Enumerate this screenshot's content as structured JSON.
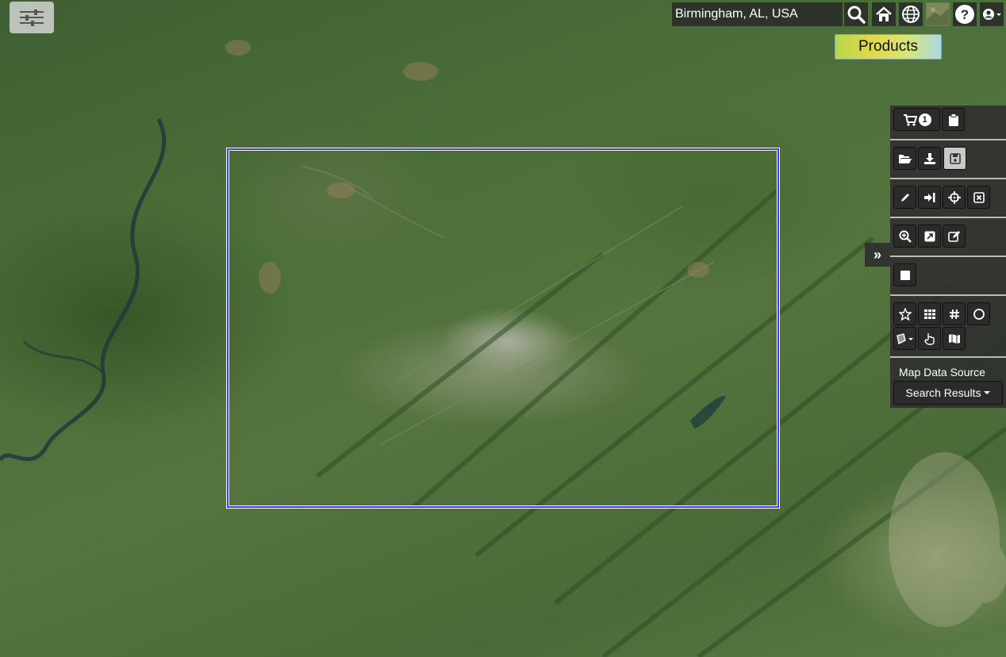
{
  "search": {
    "value": "Birmingham, AL, USA"
  },
  "products_label": "Products",
  "cart_count": "1",
  "map_data_source": {
    "label": "Map Data Source",
    "selected": "Search Results"
  },
  "expand_symbol": "»",
  "colors": {
    "aoi_border": "#3b3bff",
    "toolbar_bg": "#2d2d2d",
    "active_button": "#c9c9c9"
  },
  "icons": [
    "menu-sliders-icon",
    "search-icon",
    "home-icon",
    "globe-icon",
    "basemap-thumbnail-icon",
    "help-icon",
    "user-icon",
    "cart-icon",
    "clipboard-icon",
    "folder-open-icon",
    "download-icon",
    "save-icon",
    "pencil-icon",
    "sign-in-icon",
    "crosshairs-icon",
    "close-box-icon",
    "zoom-in-icon",
    "expand-icon",
    "edit-icon",
    "square-icon",
    "star-icon",
    "grid-icon",
    "hashtag-icon",
    "circle-icon",
    "draw-polygon-icon",
    "hand-pointer-icon",
    "map-icon"
  ]
}
